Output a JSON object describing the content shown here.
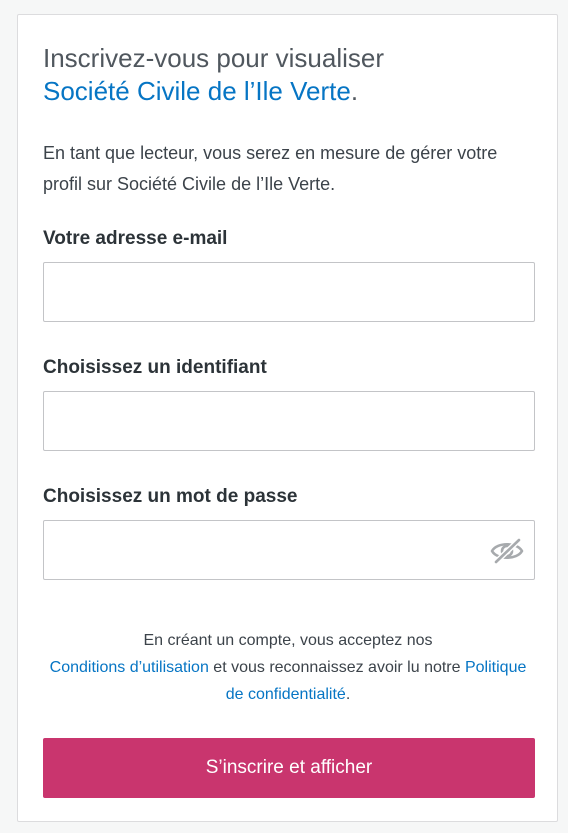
{
  "header": {
    "title_prefix": "Inscrivez-vous pour visualiser",
    "site_name": "Société Civile de l’Ile Verte",
    "title_suffix": "."
  },
  "intro": {
    "text": "En tant que lecteur, vous serez en mesure de gérer votre profil sur Société Civile de l’Ile Verte."
  },
  "form": {
    "email": {
      "label": "Votre adresse e-mail",
      "value": "",
      "placeholder": ""
    },
    "username": {
      "label": "Choisissez un identifiant",
      "value": "",
      "placeholder": ""
    },
    "password": {
      "label": "Choisissez un mot de passe",
      "value": "",
      "placeholder": "",
      "toggle_icon": "eye-slash-icon"
    }
  },
  "terms": {
    "part1": "En créant un compte, vous acceptez nos ",
    "terms_link": "Conditions d’utilisation",
    "part2": " et vous reconnaissez avoir lu notre ",
    "privacy_link": "Politique de confidentialité",
    "part3": "."
  },
  "submit": {
    "label": "S’inscrire et afficher"
  },
  "colors": {
    "accent": "#c9356e",
    "link": "#0675c4",
    "page_background": "#f6f7f7"
  }
}
